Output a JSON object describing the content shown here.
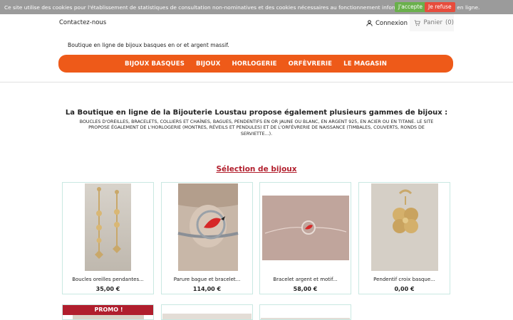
{
  "cookie_bar": {
    "text": "Ce site utilise des cookies pour l'établissement de statistiques de consultation non-nominatives et des cookies nécessaires au fonctionnement informatique de la boutique en ligne.",
    "accept_label": "J'accepte",
    "refuse_label": "Je refuse"
  },
  "header": {
    "contact_label": "Contactez-nous",
    "login_label": "Connexion",
    "cart_label": "Panier",
    "cart_count": "(0)",
    "tagline": "Boutique en ligne de bijoux basques en or et argent massif."
  },
  "menu": {
    "items": [
      {
        "label": "BIJOUX BASQUES"
      },
      {
        "label": "BIJOUX"
      },
      {
        "label": "HORLOGERIE"
      },
      {
        "label": "ORFÈVRERIE"
      },
      {
        "label": "LE MAGASIN"
      }
    ]
  },
  "intro": {
    "title": "La Boutique en ligne de la Bijouterie Loustau propose également plusieurs gammes de bijoux :",
    "body": "Boucles d'oreilles, bracelets, colliers et chaînes, bagues, pendentifs en or jaune ou blanc, en argent 925, en acier ou en titane. Le site propose également de l'horlogerie (montres, réveils et pendules) et de l'orfèvrerie de naissance (timbales, couverts, ronds de serviette...)."
  },
  "selection": {
    "title": "Sélection de bijoux"
  },
  "products": [
    {
      "name": "Boucles oreilles pendantes...",
      "price": "35,00 €"
    },
    {
      "name": "Parure bague et bracelet...",
      "price": "114,00 €"
    },
    {
      "name": "Bracelet argent et motif...",
      "price": "58,00 €"
    },
    {
      "name": "Pendentif croix basque...",
      "price": "0,00 €"
    }
  ],
  "promo_label": "PROMO !",
  "colors": {
    "accent": "#ee5a19",
    "title_red": "#b21f2d",
    "accept_green": "#6ab04c",
    "refuse_red": "#e74c3c"
  }
}
